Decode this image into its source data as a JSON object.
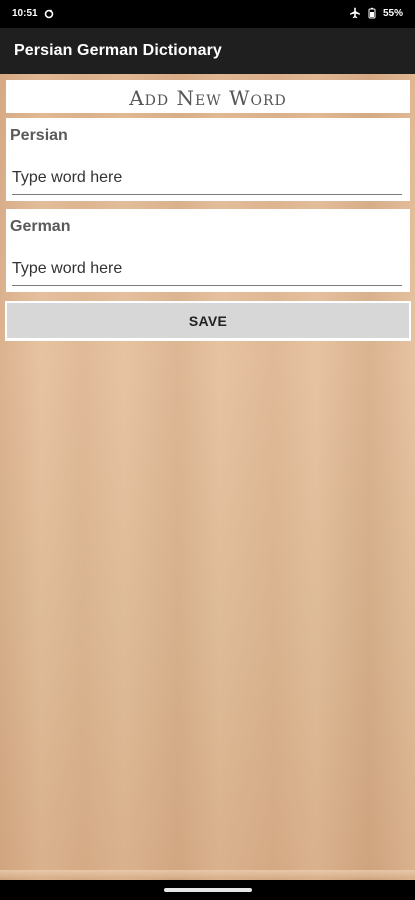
{
  "status_bar": {
    "time": "10:51",
    "battery": "55%",
    "icons": [
      "sync-icon",
      "airplane-mode-icon",
      "battery-icon"
    ]
  },
  "app_bar": {
    "title": "Persian German Dictionary"
  },
  "form": {
    "heading": "Add New Word",
    "fields": [
      {
        "label": "Persian",
        "value": "",
        "placeholder": "Type word here"
      },
      {
        "label": "German",
        "value": "",
        "placeholder": "Type word here"
      }
    ],
    "save_label": "SAVE"
  },
  "colors": {
    "status_bar": "#000000",
    "app_bar": "#1f1f1f",
    "card": "#ffffff",
    "button": "#d7d7d7",
    "label": "#5a5a5a",
    "wood": "#e3bd99"
  }
}
